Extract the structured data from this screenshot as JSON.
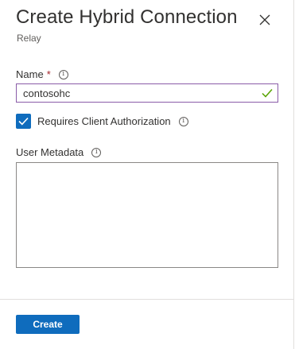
{
  "header": {
    "title": "Create Hybrid Connection",
    "subtitle": "Relay"
  },
  "icons": {
    "close": "close-icon",
    "info": "info-icon",
    "valid": "checkmark-icon",
    "checked": "checkbox-checked-icon"
  },
  "form": {
    "name": {
      "label": "Name",
      "required_marker": "*",
      "value": "contosohc",
      "placeholder": ""
    },
    "client_auth": {
      "label": "Requires Client Authorization",
      "checked": true
    },
    "user_metadata": {
      "label": "User Metadata",
      "value": ""
    }
  },
  "footer": {
    "create_label": "Create"
  },
  "colors": {
    "accent": "#0f6cbd",
    "focus_border": "#8a5ca8",
    "valid_check": "#57a300",
    "required": "#a4262c"
  }
}
